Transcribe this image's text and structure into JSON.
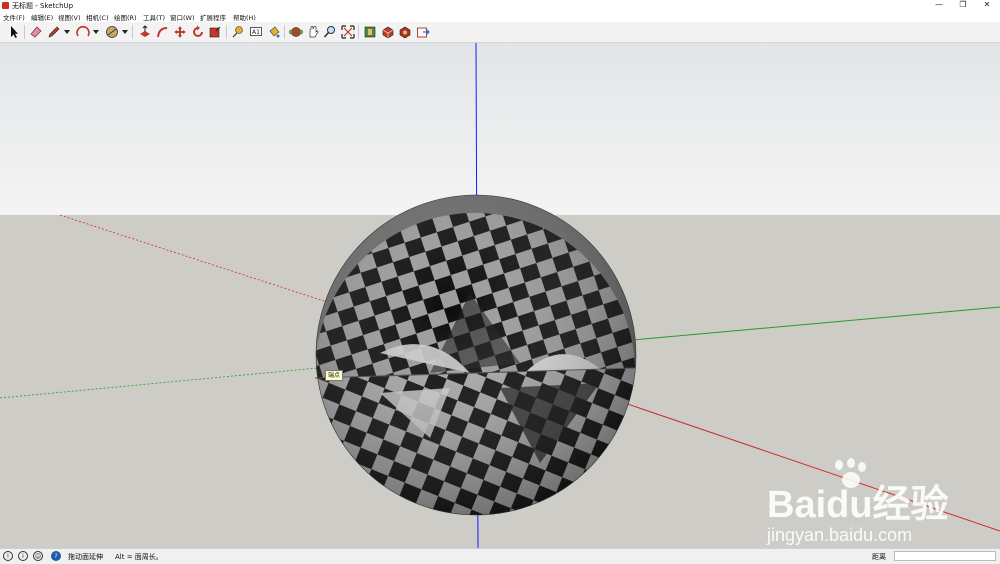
{
  "window": {
    "title": "无标题 - SketchUp",
    "minimize": "—",
    "restore": "❐",
    "close": "✕"
  },
  "menu": {
    "items": [
      "文件(F)",
      "编辑(E)",
      "视图(V)",
      "相机(C)",
      "绘图(R)",
      "工具(T)",
      "窗口(W)",
      "扩展程序",
      "帮助(H)"
    ]
  },
  "toolbar": {
    "tools": [
      "select",
      "eraser",
      "pencil",
      "arc",
      "shapes",
      "push-pull",
      "follow-me",
      "move",
      "rotate",
      "scale",
      "tape-measure",
      "text",
      "paint-bucket",
      "orbit",
      "pan",
      "zoom",
      "zoom-extents",
      "warehouse",
      "extension-warehouse",
      "components",
      "layout"
    ]
  },
  "colors": {
    "sky_top": "#e2e5e7",
    "sky_bottom": "#f4f4f4",
    "ground": "#cdccc7",
    "axis_blue": "#1a1aff",
    "axis_red": "#d42a2a",
    "axis_green": "#2a9a2a"
  },
  "viewport": {
    "tooltip": "端点"
  },
  "status": {
    "hint": "拖动面延伸",
    "alt_hint": "Alt = 面周长。",
    "measure_label": "距离",
    "measure_value": ""
  },
  "watermark": {
    "brand": "Baidu经验",
    "url": "jingyan.baidu.com"
  }
}
